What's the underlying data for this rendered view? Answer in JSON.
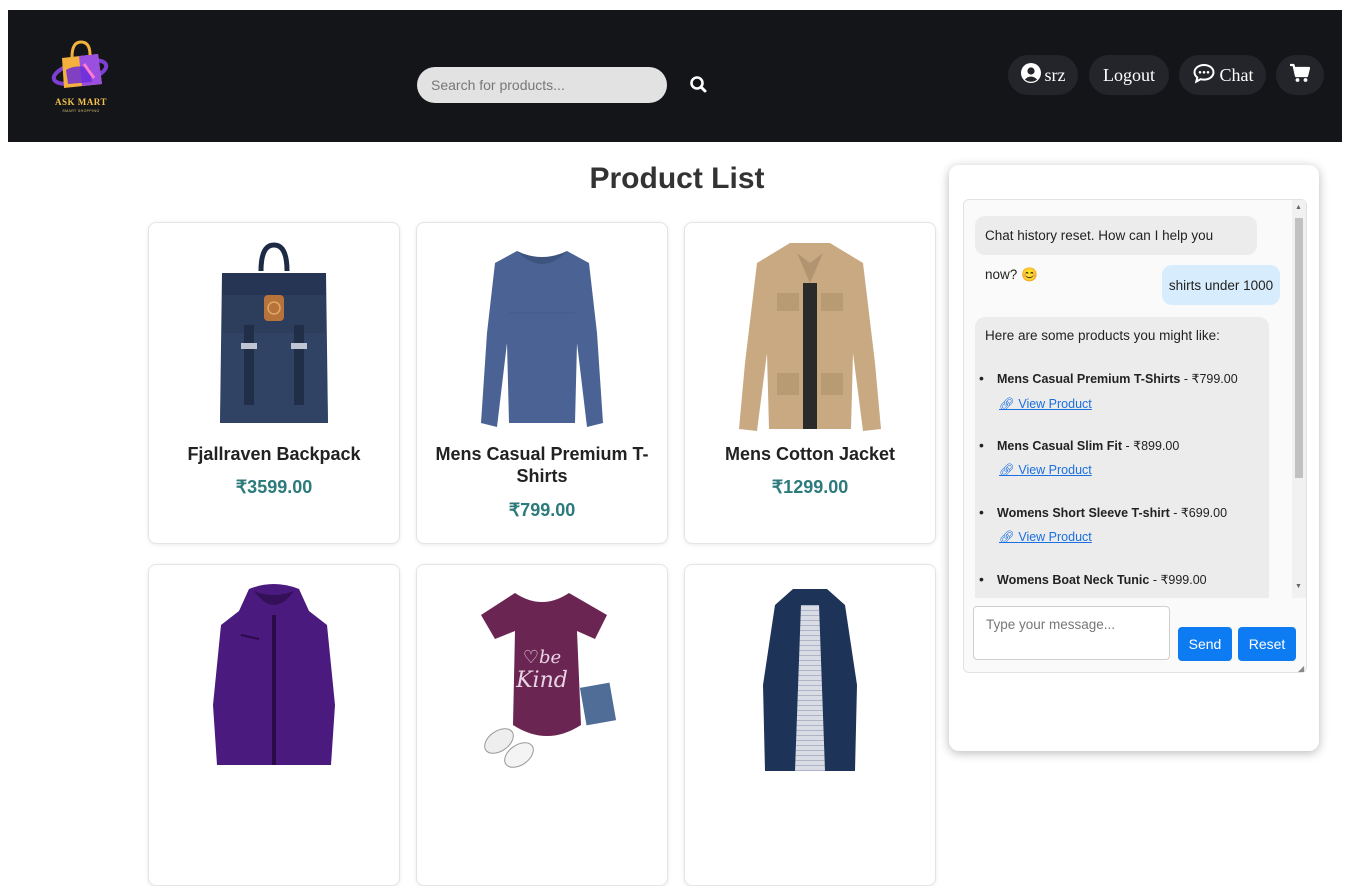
{
  "header": {
    "logo_text": "ASK MART",
    "logo_subtitle": "SMART SHOPPING",
    "search_placeholder": "Search for products...",
    "user_label": "srz",
    "logout_label": "Logout",
    "chat_label": "Chat"
  },
  "main": {
    "title": "Product List",
    "products": [
      {
        "name": "Fjallraven Backpack",
        "price": "₹3599.00"
      },
      {
        "name": "Mens Casual Premium T-Shirts",
        "price": "₹799.00"
      },
      {
        "name": "Mens Cotton Jacket",
        "price": "₹1299.00"
      },
      {
        "name": "",
        "price": ""
      },
      {
        "name": "",
        "price": ""
      },
      {
        "name": "",
        "price": ""
      }
    ]
  },
  "chat": {
    "messages": [
      {
        "from": "bot",
        "text": "Chat history reset. How can I help you now? 😊"
      },
      {
        "from": "user",
        "text": "shirts under 1000"
      },
      {
        "from": "bot",
        "intro": "Here are some products you might like:"
      }
    ],
    "suggestions": [
      {
        "name": "Mens Casual Premium T-Shirts",
        "price": " - ₹799.00",
        "link": "View Product"
      },
      {
        "name": "Mens Casual Slim Fit",
        "price": " - ₹899.00",
        "link": "View Product"
      },
      {
        "name": "Womens Short Sleeve T-shirt",
        "price": " - ₹699.00",
        "link": "View Product"
      },
      {
        "name": "Womens Boat Neck Tunic",
        "price": " - ₹999.00",
        "link": ""
      }
    ],
    "input_placeholder": "Type your message...",
    "send_label": "Send",
    "reset_label": "Reset"
  },
  "colors": {
    "navbar": "#141518",
    "accent_price": "#2c7a7b",
    "button": "#0d7bf2",
    "user_bubble": "#d7ecfc"
  }
}
